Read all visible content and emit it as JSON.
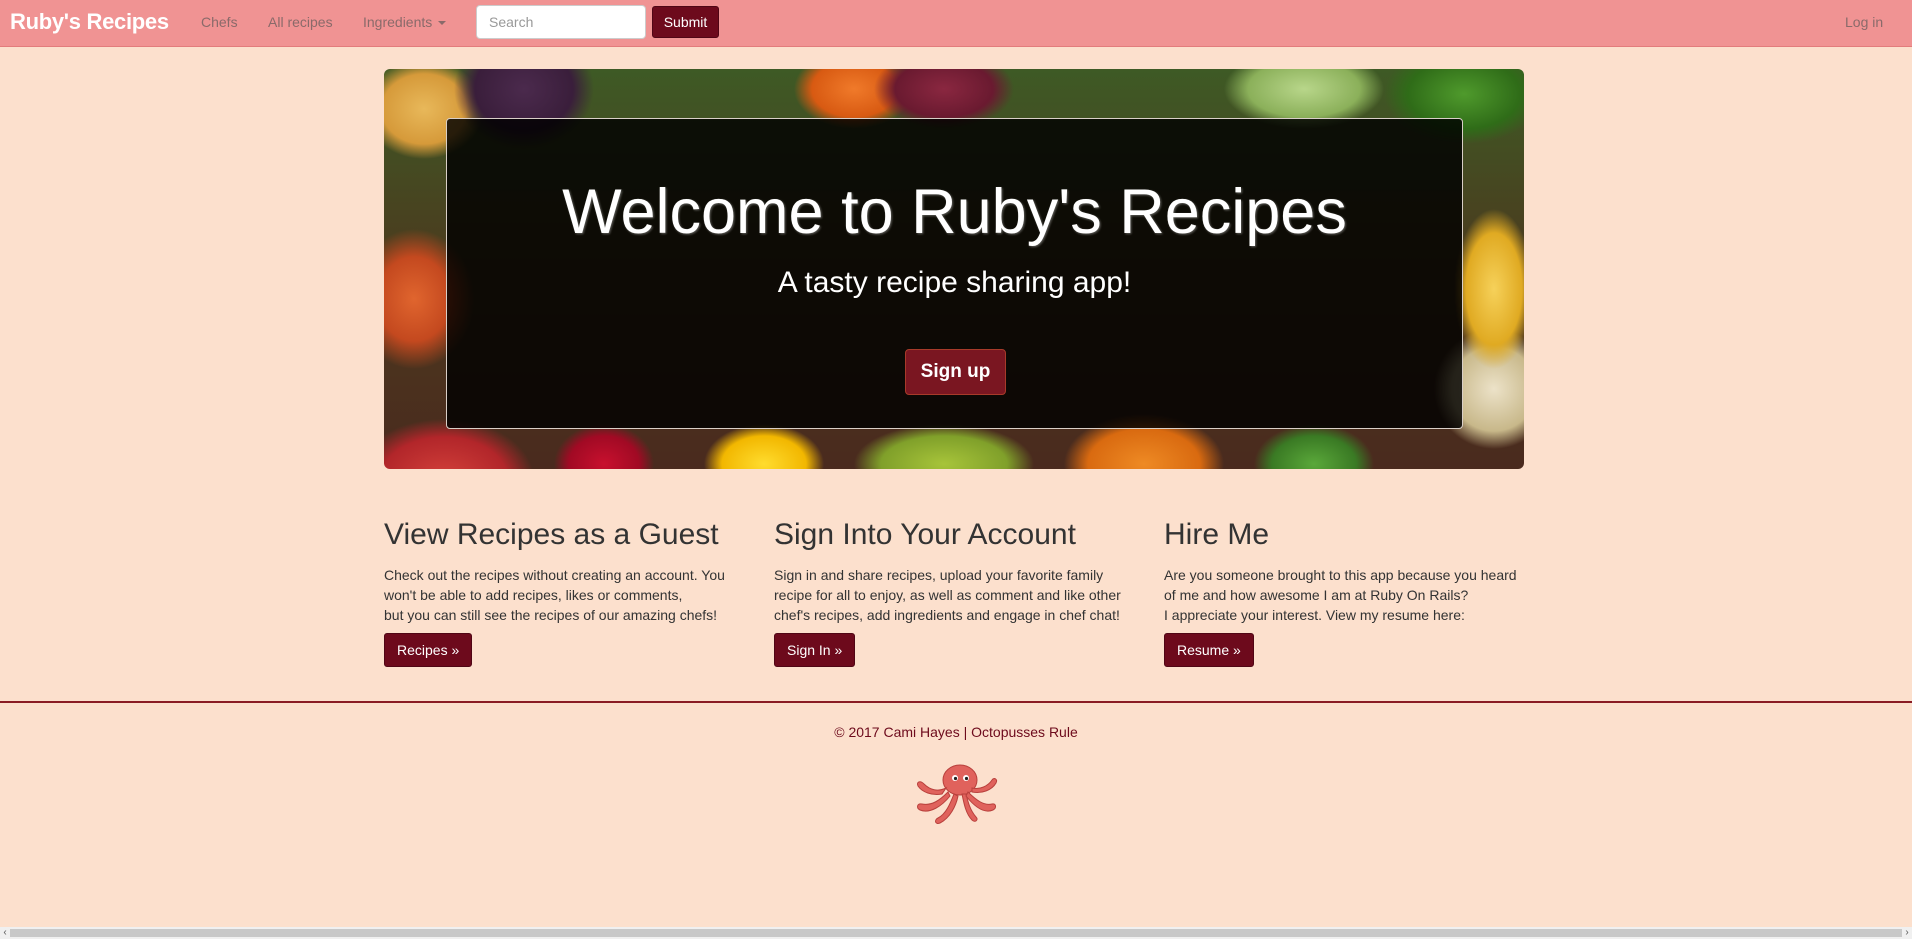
{
  "navbar": {
    "brand": "Ruby's Recipes",
    "links": {
      "chefs": "Chefs",
      "all_recipes": "All recipes",
      "ingredients": "Ingredients"
    },
    "search": {
      "placeholder": "Search",
      "value": ""
    },
    "submit_label": "Submit",
    "login_label": "Log in"
  },
  "hero": {
    "title": "Welcome to Ruby's Recipes",
    "subtitle": "A tasty recipe sharing app!",
    "signup_label": "Sign up"
  },
  "columns": [
    {
      "heading": "View Recipes as a Guest",
      "lines": [
        "Check out the recipes without creating an account. You",
        "won't be able to add recipes, likes or comments,",
        "but you can still see the recipes of our amazing chefs!"
      ],
      "button": "Recipes »"
    },
    {
      "heading": "Sign Into Your Account",
      "lines": [
        "Sign in and share recipes, upload your favorite family",
        "recipe for all to enjoy, as well as comment and like other",
        "chef's recipes, add ingredients and engage in chef chat!"
      ],
      "button": "Sign In »"
    },
    {
      "heading": "Hire Me",
      "lines": [
        "Are you someone brought to this app because you heard",
        "of me and how awesome I am at Ruby On Rails?",
        "I appreciate your interest. View my resume here:"
      ],
      "button": "Resume »"
    }
  ],
  "footer": {
    "text": "© 2017 Cami Hayes | Octopusses Rule",
    "logo_icon": "octopus-icon"
  },
  "colors": {
    "navbar": "#f09393",
    "background": "#fce0cd",
    "button": "#6d0a1c",
    "footer_line": "#8a1c24"
  }
}
